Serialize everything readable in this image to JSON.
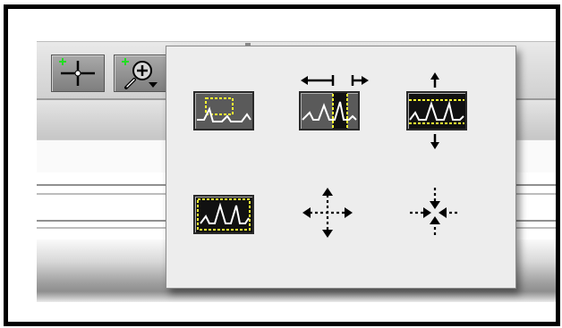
{
  "colors": {
    "accent_yellow": "#ffff33",
    "trace_white": "#ffffff",
    "thumb_gray": "#5a5a5a",
    "thumb_black": "#111111",
    "plus_green": "#22dd22"
  },
  "toolbar": {
    "buttons": [
      {
        "icon": "crosshair-cursor-icon"
      },
      {
        "icon": "zoom-magnifier-icon"
      }
    ]
  },
  "zoom_popup": {
    "options": [
      {
        "icon": "zoom-box-icon"
      },
      {
        "icon": "zoom-horizontal-icon"
      },
      {
        "icon": "zoom-vertical-icon"
      },
      {
        "icon": "zoom-fit-icon"
      },
      {
        "icon": "zoom-out-all-directions-icon"
      },
      {
        "icon": "zoom-in-all-directions-icon"
      }
    ]
  }
}
